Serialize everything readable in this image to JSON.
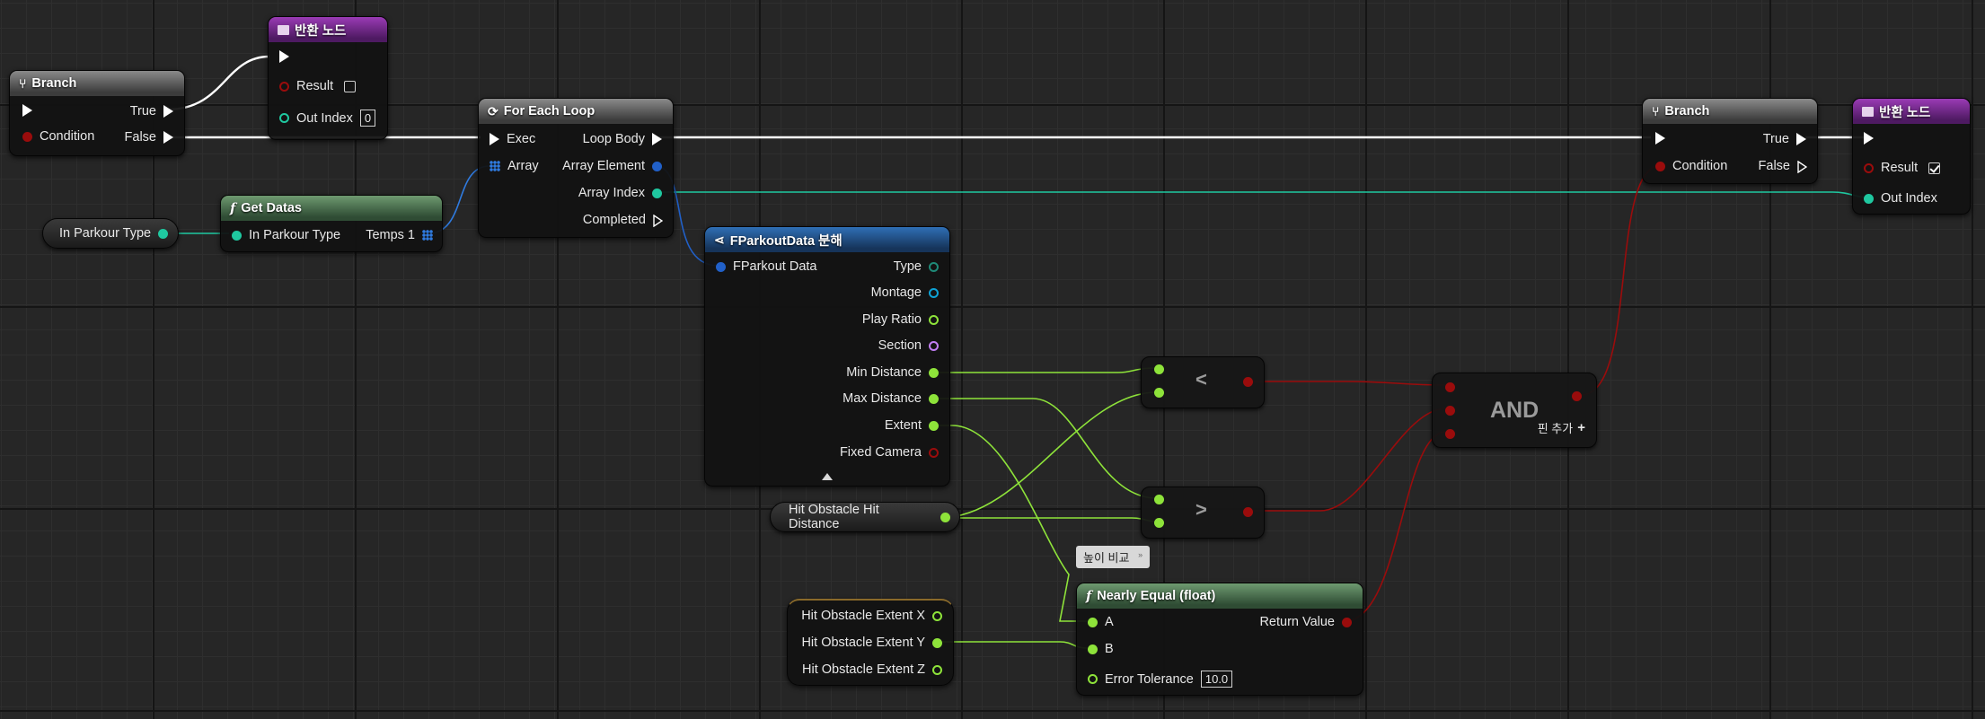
{
  "nodes": {
    "branch1": {
      "title": "Branch",
      "pins": {
        "true": "True",
        "condition": "Condition",
        "false": "False"
      }
    },
    "return1": {
      "title": "반환 노드",
      "pins": {
        "result": "Result",
        "out_index": "Out Index",
        "out_index_value": "0"
      }
    },
    "for_each": {
      "title": "For Each Loop",
      "pins": {
        "exec": "Exec",
        "loop_body": "Loop Body",
        "array": "Array",
        "array_element": "Array Element",
        "array_index": "Array Index",
        "completed": "Completed"
      }
    },
    "get_datas": {
      "title": "Get Datas",
      "pins": {
        "in_parkour_type": "In Parkour Type",
        "temps": "Temps 1"
      }
    },
    "var_in_parkour_type": {
      "label": "In Parkour Type"
    },
    "break_struct": {
      "title": "FParkoutData 분해",
      "pins": {
        "input": "FParkout Data",
        "type": "Type",
        "montage": "Montage",
        "play_ratio": "Play Ratio",
        "section": "Section",
        "min_distance": "Min Distance",
        "max_distance": "Max Distance",
        "extent": "Extent",
        "fixed_camera": "Fixed Camera"
      }
    },
    "branch2": {
      "title": "Branch",
      "pins": {
        "true": "True",
        "condition": "Condition",
        "false": "False"
      }
    },
    "return2": {
      "title": "반환 노드",
      "pins": {
        "result": "Result",
        "out_index": "Out Index"
      }
    },
    "less_than": {
      "symbol": "<"
    },
    "greater_than": {
      "symbol": ">"
    },
    "and_node": {
      "symbol": "AND",
      "add_pin": "핀 추가"
    },
    "var_hit_distance": {
      "label": "Hit Obstacle Hit Distance"
    },
    "var_hit_extent": {
      "pins": {
        "x": "Hit Obstacle Extent X",
        "y": "Hit Obstacle Extent Y",
        "z": "Hit Obstacle Extent Z"
      }
    },
    "comment": {
      "text": "높이 비교"
    },
    "nearly_equal": {
      "title": "Nearly Equal (float)",
      "pins": {
        "a": "A",
        "b": "B",
        "return_value": "Return Value",
        "error_tolerance": "Error Tolerance",
        "error_tolerance_value": "10.0"
      }
    }
  },
  "colors": {
    "exec": "#ffffff",
    "bool": "#9a0c0c",
    "int": "#1fc8a0",
    "float": "#8ee33a",
    "struct": "#2160c8",
    "object": "#0ea3d6",
    "name": "#c17ef3",
    "array": "#2f7be0"
  }
}
